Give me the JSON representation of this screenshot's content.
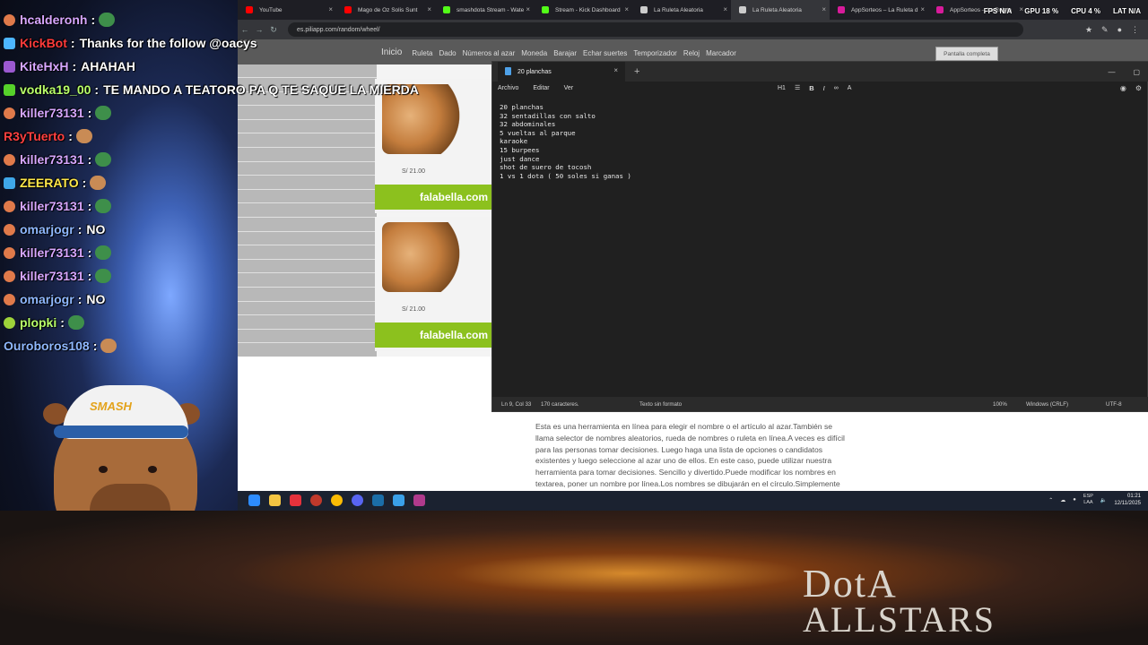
{
  "browser": {
    "tabs": [
      {
        "label": "YouTube",
        "color": "#ff0000"
      },
      {
        "label": "Mago de Oz Solis Sunt",
        "color": "#ff0000"
      },
      {
        "label": "smashdota Stream - Wate",
        "color": "#53fc18"
      },
      {
        "label": "Stream - Kick Dashboard",
        "color": "#53fc18"
      },
      {
        "label": "La Ruleta Aleatoria",
        "color": "#cccccc"
      },
      {
        "label": "La Ruleta Aleatoria",
        "color": "#cccccc"
      },
      {
        "label": "AppSorteos – La Ruleta d",
        "color": "#d81b9b"
      },
      {
        "label": "AppSorteos – La Ruleta",
        "color": "#d81b9b"
      }
    ],
    "url": "es.piliapp.com/random/wheel/",
    "page_nav": {
      "home": "Inicio",
      "items": [
        "Ruleta",
        "Dado",
        "Números al azar",
        "Moneda",
        "Barajar",
        "Echar suertes",
        "Temporizador",
        "Reloj",
        "Marcador"
      ]
    },
    "fullscreen_label": "Pantalla completa",
    "ads": [
      {
        "price": "S/ 21.00",
        "brand": "falabella.com"
      },
      {
        "price": "S/ 21.00",
        "brand": "falabella.com"
      }
    ],
    "ads_partial_price": "S/ 2",
    "description": "Esta es una herramienta en línea para elegir el nombre o el artículo al azar.También se llama selector de nombres aleatorios, rueda de nombres o ruleta en línea.A veces es difícil para las personas tomar decisiones. Luego haga una lista de opciones o candidatos existentes y luego seleccione al azar uno de ellos. En este caso, puede utilizar nuestra herramienta para tomar decisiones. Sencillo y divertido.Puede modificar los nombres en textarea, poner un nombre por línea.Los nombres se dibujarán en el círculo.Simplemente haga clic en la rueda"
  },
  "notepad": {
    "tab_title": "20 planchas",
    "menu": [
      "Archivo",
      "Editar",
      "Ver"
    ],
    "heading_selector": "H1",
    "content": "20 planchas\n32 sentadillas con salto\n32 abdominales\n5 vueltas al parque\nkaraoke\n15 burpees\njust dance\nshot de suero de tocosh\n1 vs 1 dota ( 50 soles si ganas )",
    "status": {
      "position": "Ln 9, Col 33",
      "chars": "170 caracteres.",
      "format": "Texto sin formato",
      "zoom": "100%",
      "eol": "Windows (CRLF)",
      "encoding": "UTF-8"
    }
  },
  "stats": {
    "fps_label": "FPS",
    "fps_value": "N/A",
    "gpu_label": "GPU",
    "gpu_value": "18 %",
    "cpu_label": "CPU",
    "cpu_value": "4 %",
    "lat_label": "LAT",
    "lat_value": "N/A"
  },
  "taskbar": {
    "lang": "ESP",
    "lang_sub": "LAA",
    "time": "01:21",
    "date": "12/11/2025"
  },
  "chat": [
    {
      "user": "hcalderonh",
      "color": "#d7a7ff",
      "msg": "",
      "emote": true,
      "badge": "#e07a4a",
      "circle": true
    },
    {
      "user": "KickBot",
      "color": "#ff3b3b",
      "msg": "Thanks for the follow @oacys",
      "emote": false,
      "badge": "#4db6ff",
      "circle": false
    },
    {
      "user": "KiteHxH",
      "color": "#d7a7ff",
      "msg": "AHAHAH",
      "emote": false,
      "badge": "#9b59d0",
      "circle": false
    },
    {
      "user": "vodka19_00",
      "color": "#b8ff6a",
      "msg": "TE MANDO A TEATORO PA Q TE SAQUE LA MIERDA",
      "emote": false,
      "badge": "#56d12a",
      "circle": false
    },
    {
      "user": "killer73131",
      "color": "#d7a7ff",
      "msg": "",
      "emote": true,
      "badge": "#e07a4a",
      "circle": true
    },
    {
      "user": "R3yTuerto",
      "color": "#ff4040",
      "msg": "",
      "emote": true,
      "badge": "",
      "circle": false
    },
    {
      "user": "killer73131",
      "color": "#d7a7ff",
      "msg": "",
      "emote": true,
      "badge": "#e07a4a",
      "circle": true
    },
    {
      "user": "ZEERATO",
      "color": "#ffe84a",
      "msg": "",
      "emote": true,
      "badge": "#3fa7e8",
      "circle": false
    },
    {
      "user": "killer73131",
      "color": "#d7a7ff",
      "msg": "",
      "emote": true,
      "badge": "#e07a4a",
      "circle": true
    },
    {
      "user": "omarjogr",
      "color": "#8fb8ff",
      "msg": "NO",
      "emote": false,
      "badge": "#e07a4a",
      "circle": true
    },
    {
      "user": "killer73131",
      "color": "#d7a7ff",
      "msg": "",
      "emote": true,
      "badge": "#e07a4a",
      "circle": true
    },
    {
      "user": "killer73131",
      "color": "#d7a7ff",
      "msg": "",
      "emote": true,
      "badge": "#e07a4a",
      "circle": true
    },
    {
      "user": "omarjogr",
      "color": "#8fb8ff",
      "msg": "NO",
      "emote": false,
      "badge": "#e07a4a",
      "circle": true
    },
    {
      "user": "plopki",
      "color": "#b8ff6a",
      "msg": "",
      "emote": true,
      "badge": "#9ed33a",
      "circle": true
    },
    {
      "user": "Ouroboros108",
      "color": "#8fb8ff",
      "msg": "",
      "emote": true,
      "badge": "",
      "circle": false
    }
  ],
  "avatar": {
    "cap_text": "SMASH"
  },
  "game_logo": {
    "line1": "DotA",
    "line2": "ALLSTARS"
  }
}
